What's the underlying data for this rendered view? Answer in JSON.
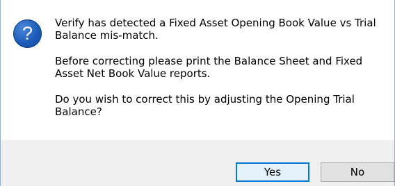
{
  "dialog": {
    "icon": "question-icon",
    "icon_glyph": "?",
    "messages": [
      "Verify has detected a Fixed Asset Opening Book Value vs Trial Balance mis-match.",
      "Before correcting please print the Balance Sheet and Fixed Asset Net Book Value reports.",
      "Do you wish to correct this by adjusting the Opening Trial Balance?"
    ],
    "buttons": {
      "yes_label": "Yes",
      "no_label": "No"
    }
  },
  "colors": {
    "icon_blue": "#1c5bb8",
    "focus_border": "#0078d7",
    "footer_bg": "#f0f0f0"
  }
}
